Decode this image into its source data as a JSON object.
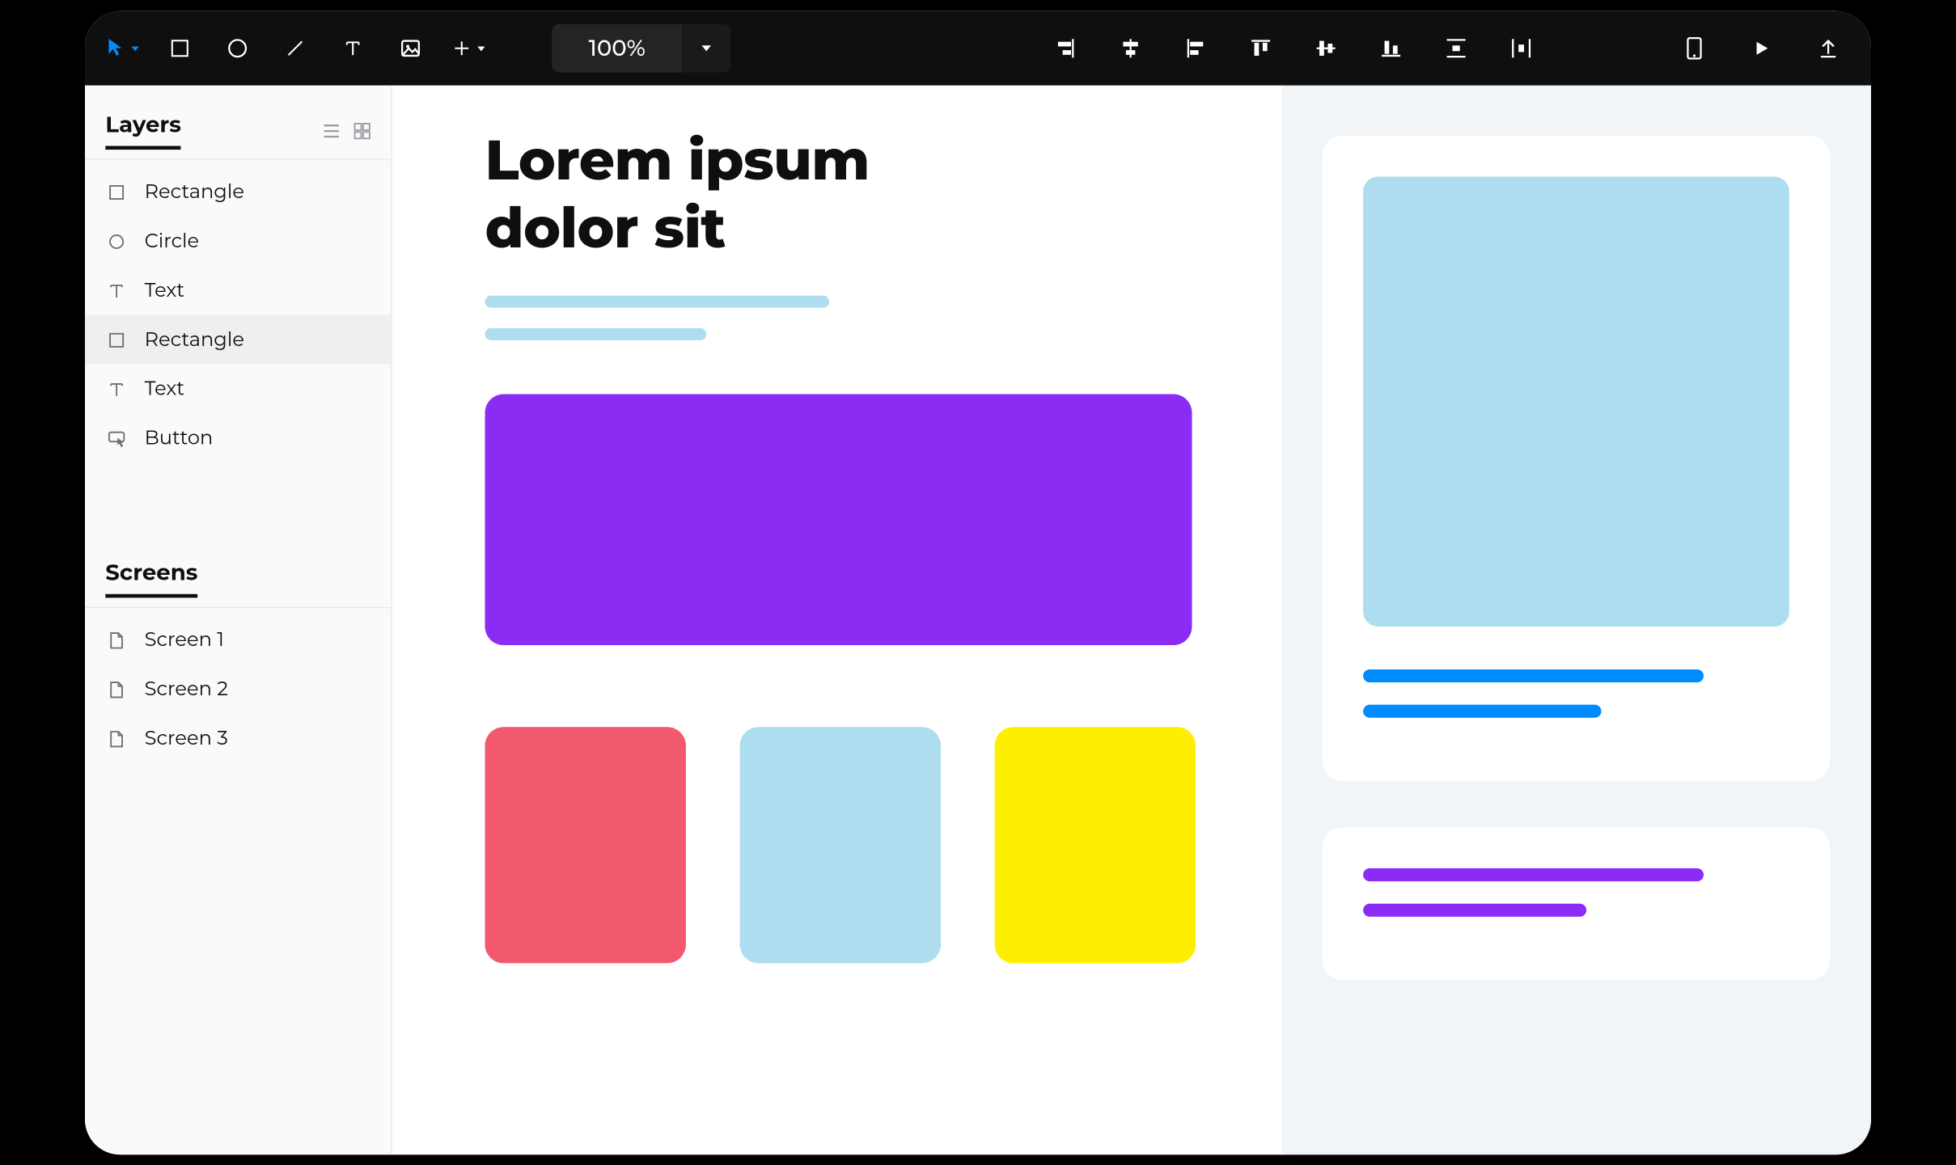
{
  "toolbar": {
    "zoom": "100%"
  },
  "sidebar": {
    "layers_title": "Layers",
    "screens_title": "Screens",
    "layers": [
      {
        "icon": "rect",
        "label": "Rectangle",
        "selected": false
      },
      {
        "icon": "circle",
        "label": "Circle",
        "selected": false
      },
      {
        "icon": "text",
        "label": "Text",
        "selected": false
      },
      {
        "icon": "rect",
        "label": "Rectangle",
        "selected": true
      },
      {
        "icon": "text",
        "label": "Text",
        "selected": false
      },
      {
        "icon": "button",
        "label": "Button",
        "selected": false
      }
    ],
    "screens": [
      {
        "label": "Screen 1"
      },
      {
        "label": "Screen 2"
      },
      {
        "label": "Screen 3"
      }
    ]
  },
  "canvas": {
    "title": "Lorem ipsum dolor sit",
    "subtitle_color": "#aeddef",
    "subtitle_line_widths": [
      370,
      238
    ],
    "banner_color": "#8b2cf5",
    "tiles": [
      {
        "color": "#f2586e"
      },
      {
        "color": "#aeddef"
      },
      {
        "color": "#feee00"
      }
    ]
  },
  "inspector": {
    "card1": {
      "thumb_color": "#aeddef",
      "line_color": "#008cff",
      "line_widths": [
        366,
        256
      ]
    },
    "card2": {
      "line_color": "#8b2cf5",
      "line_widths": [
        366,
        240
      ]
    }
  }
}
